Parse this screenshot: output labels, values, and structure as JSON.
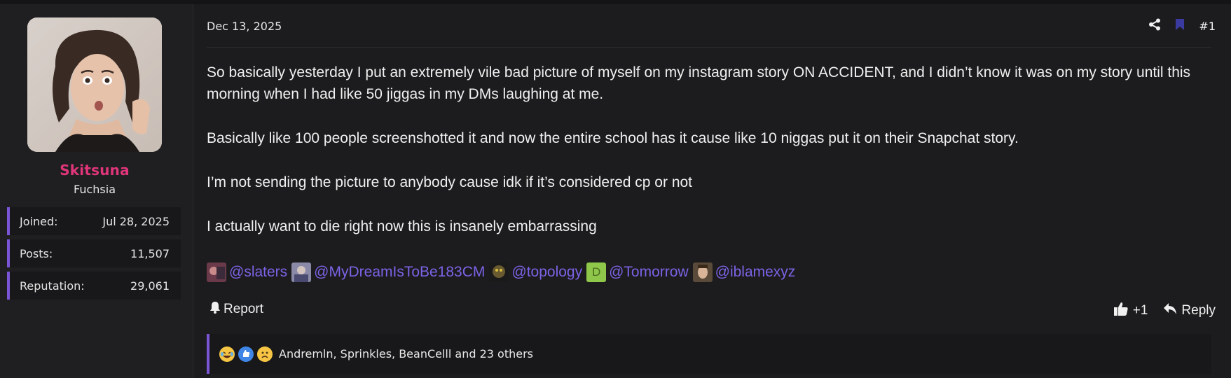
{
  "author": {
    "username": "Skitsuna",
    "title": "Fuchsia",
    "stats": [
      {
        "label": "Joined:",
        "value": "Jul 28, 2025"
      },
      {
        "label": "Posts:",
        "value": "11,507"
      },
      {
        "label": "Reputation:",
        "value": "29,061"
      }
    ],
    "accent_color": "#e0357a"
  },
  "post": {
    "date": "Dec 13, 2025",
    "number": "#1",
    "paragraphs": [
      "So basically yesterday I put an extremely vile bad picture of myself on my instagram story ON ACCIDENT, and I didn’t know it was on my story until this morning when I had like 50 jiggas in my DMs laughing at me.",
      "Basically like 100 people screenshotted it and now the entire school has it cause like 10 niggas put it on their Snapchat story.",
      "I’m not sending the picture to anybody cause idk if it’s considered cp or not",
      "I actually want to die right now this is insanely embarrassing"
    ],
    "mentions": [
      {
        "name": "@slaters"
      },
      {
        "name": "@MyDreamIsToBe183CM"
      },
      {
        "name": "@topology"
      },
      {
        "name": "@Tomorrow",
        "letter": "D"
      },
      {
        "name": "@iblamexyz"
      }
    ],
    "mention_color": "#7c63e6"
  },
  "actions": {
    "report_label": "Report",
    "like_label": "+1",
    "reply_label": "Reply"
  },
  "reactions": {
    "summary": "Andremln, Sprinkles, BeanCelll and 23 others",
    "emoji_icons": [
      "laughing-crying-icon",
      "thumbs-up-icon",
      "sad-face-icon"
    ]
  },
  "icons": {
    "share": "share-icon",
    "bookmark": "bookmark-icon",
    "bell": "bell-icon",
    "like": "thumbs-up-icon",
    "reply": "reply-icon"
  },
  "colors": {
    "border_accent": "#7a55d6",
    "background": "#1c1c1e"
  }
}
